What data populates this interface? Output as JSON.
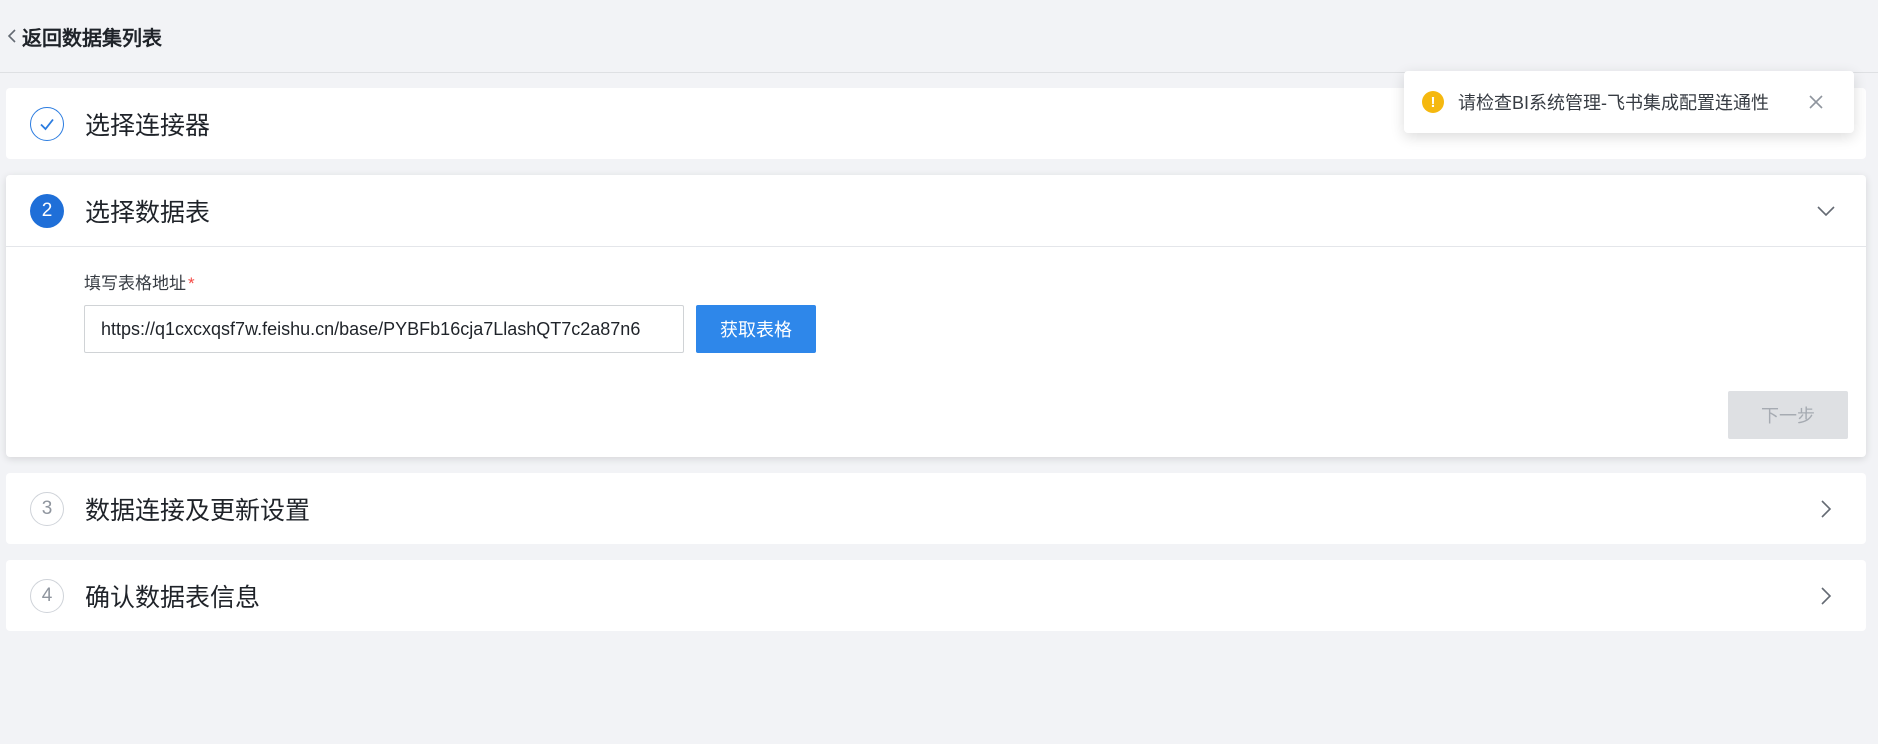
{
  "header": {
    "back_label": "返回数据集列表"
  },
  "steps": [
    {
      "index": "1",
      "title": "选择连接器",
      "state": "done"
    },
    {
      "index": "2",
      "title": "选择数据表",
      "state": "active"
    },
    {
      "index": "3",
      "title": "数据连接及更新设置",
      "state": "pending"
    },
    {
      "index": "4",
      "title": "确认数据表信息",
      "state": "pending"
    }
  ],
  "form": {
    "field_label": "填写表格地址",
    "required_mark": "*",
    "url_value": "https://q1cxcxqsf7w.feishu.cn/base/PYBFb16cja7LlashQT7c2a87n6",
    "fetch_button": "获取表格",
    "next_button": "下一步"
  },
  "toast": {
    "icon": "warning-icon",
    "icon_glyph": "!",
    "message": "请检查BI系统管理-飞书集成配置连通性"
  },
  "colors": {
    "accent": "#2e87ea",
    "active_step": "#1f6fd8",
    "warning": "#f5b80f",
    "required": "#f54a45",
    "background": "#f2f3f6"
  }
}
